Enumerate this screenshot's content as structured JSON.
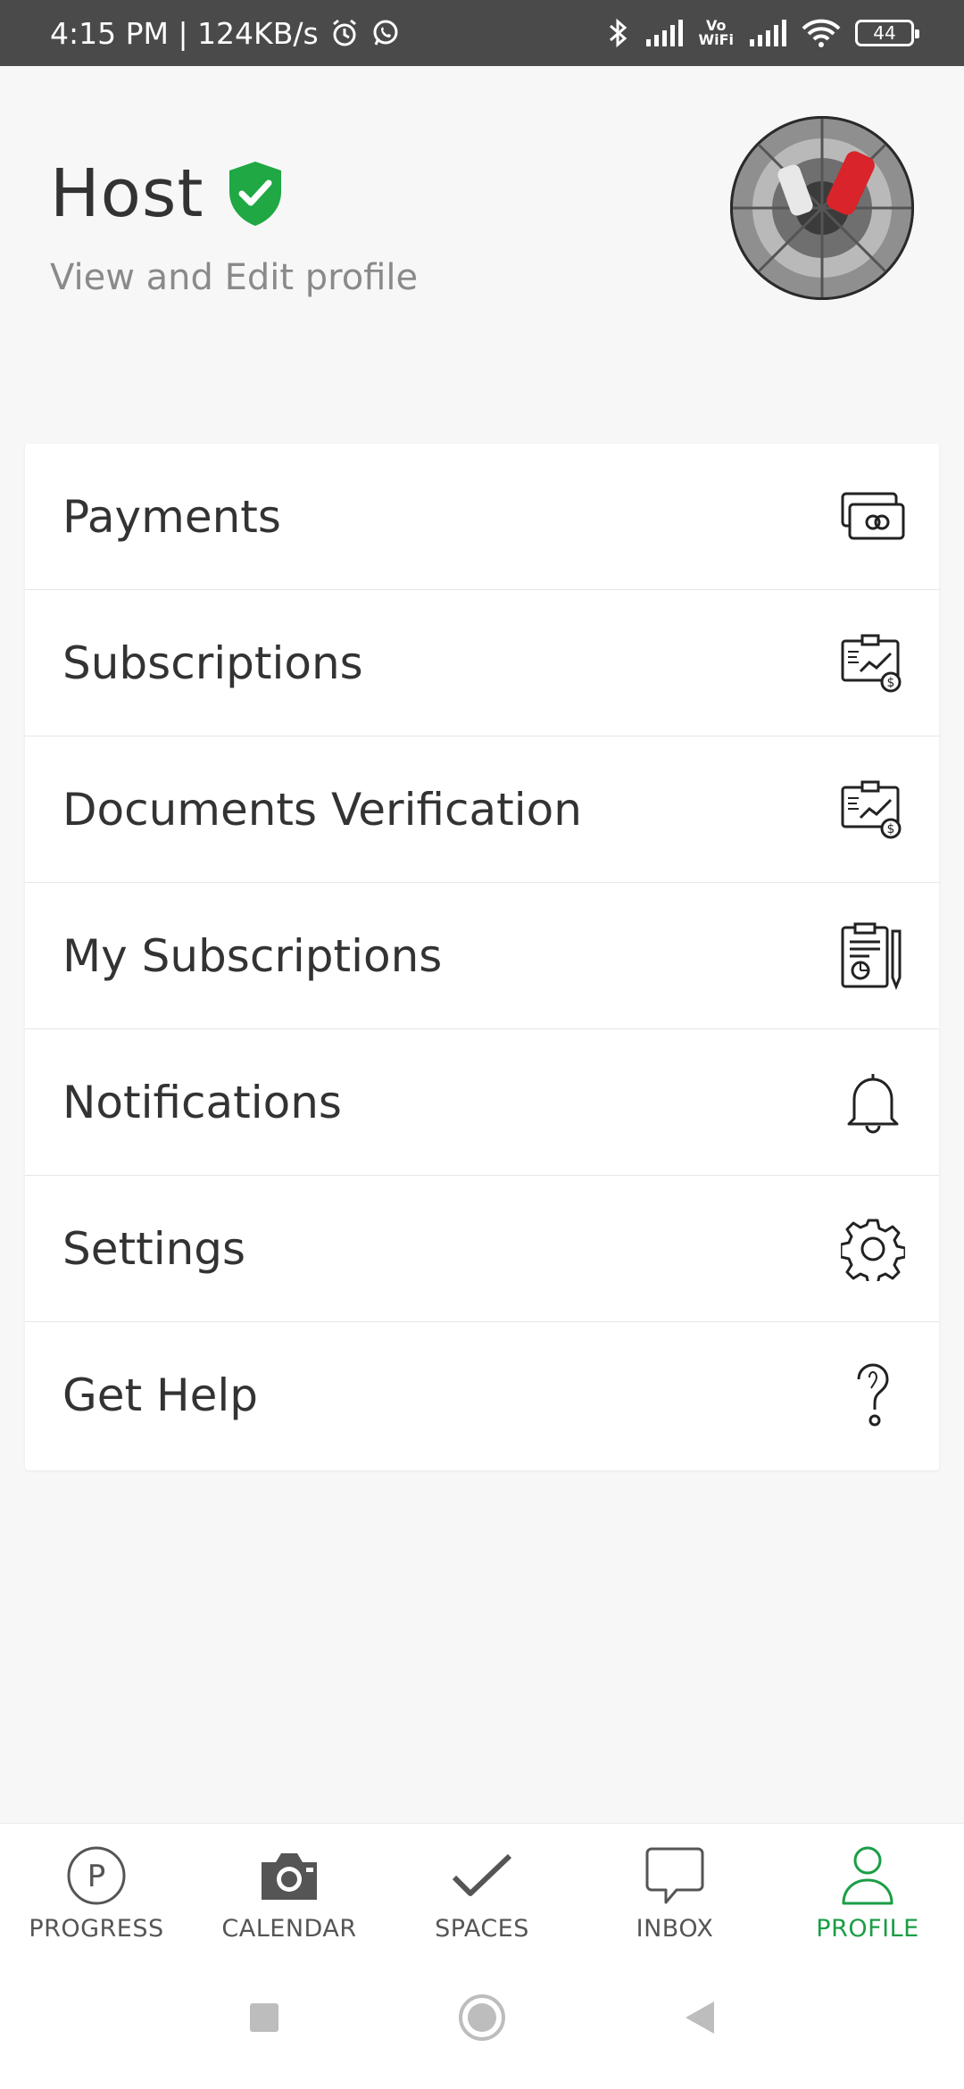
{
  "status_bar": {
    "time_speed": "4:15 PM | 124KB/s",
    "vowifi_top": "Vo",
    "vowifi_bottom": "WiFi",
    "battery": "44",
    "icons": [
      "alarm-icon",
      "whatsapp-icon",
      "bluetooth-icon",
      "signal-icon",
      "wifi-icon",
      "battery-icon"
    ]
  },
  "profile": {
    "name": "Host",
    "edit_link": "View and Edit profile",
    "verified_color": "#1fa843"
  },
  "menu": {
    "items": [
      {
        "label": "Payments",
        "icon": "cards-icon"
      },
      {
        "label": "Subscriptions",
        "icon": "report-dollar-icon"
      },
      {
        "label": "Documents Verification",
        "icon": "report-dollar-icon"
      },
      {
        "label": "My Subscriptions",
        "icon": "clipboard-pen-icon"
      },
      {
        "label": "Notifications",
        "icon": "bell-icon"
      },
      {
        "label": "Settings",
        "icon": "gear-icon"
      },
      {
        "label": "Get Help",
        "icon": "question-icon"
      }
    ]
  },
  "bottom_nav": {
    "items": [
      {
        "label": "PROGRESS",
        "icon": "parking-icon"
      },
      {
        "label": "CALENDAR",
        "icon": "camera-icon"
      },
      {
        "label": "SPACES",
        "icon": "check-icon"
      },
      {
        "label": "INBOX",
        "icon": "chat-bubble-icon"
      },
      {
        "label": "PROFILE",
        "icon": "person-icon"
      }
    ],
    "active": "PROFILE",
    "accent": "#1a9e45"
  }
}
